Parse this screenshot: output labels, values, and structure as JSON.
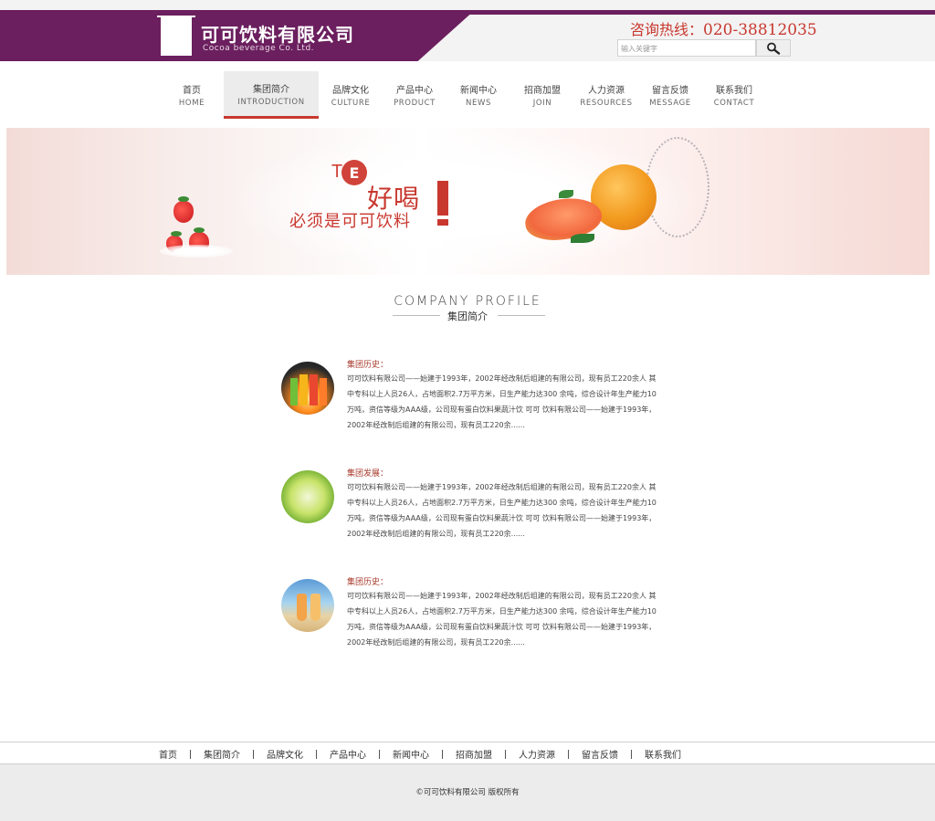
{
  "header": {
    "company_name": "可可饮料有限公司",
    "company_en": "Cocoa beverage Co. Ltd.",
    "hotline_label": "咨询热线：",
    "hotline_number": "020-38812035",
    "search_placeholder": "输入关键字",
    "brand_color": "#6b1f5e",
    "accent_color": "#c8382f"
  },
  "nav": {
    "items": [
      {
        "cn": "首页",
        "en": "HOME"
      },
      {
        "cn": "集团简介",
        "en": "INTRODUCTION"
      },
      {
        "cn": "品牌文化",
        "en": "CULTURE"
      },
      {
        "cn": "产品中心",
        "en": "PRODUCT"
      },
      {
        "cn": "新闻中心",
        "en": "NEWS"
      },
      {
        "cn": "招商加盟",
        "en": "JOIN"
      },
      {
        "cn": "人力资源",
        "en": "RESOURCES"
      },
      {
        "cn": "留言反馈",
        "en": "MESSAGE"
      },
      {
        "cn": "联系我们",
        "en": "CONTACT"
      }
    ],
    "active": "集团简介"
  },
  "banner": {
    "te": "TE",
    "slogan_big": "好喝",
    "slogan_small": "必须是可可饮料"
  },
  "section": {
    "title_en": "COMPANY PROFILE",
    "title_cn": "集团简介"
  },
  "entries": [
    {
      "heading": "集团历史：",
      "text": "可可饮料有限公司——始建于1993年，2002年经改制后组建的有限公司，现有员工220余人 其中专科以上人员26人，占地面积2.7万平方米，日生产能力达300 余吨，综合设计年生产能力10万吨，资信等级为AAA级，公司现有蛋白饮料果蔬汁饮 可可 饮料有限公司——始建于1993年，2002年经改制后组建的有限公司，现有员工220余......",
      "thumb": "juice-glasses-image"
    },
    {
      "heading": "集团发展：",
      "text": "可可饮料有限公司——始建于1993年，2002年经改制后组建的有限公司，现有员工220余人 其中专科以上人员26人，占地面积2.7万平方米，日生产能力达300 余吨，综合设计年生产能力10万吨，资信等级为AAA级，公司现有蛋白饮料果蔬汁饮 可可 饮料有限公司——始建于1993年，2002年经改制后组建的有限公司，现有员工220余......",
      "thumb": "lime-slice-image"
    },
    {
      "heading": "集团历史：",
      "text": "可可饮料有限公司——始建于1993年，2002年经改制后组建的有限公司，现有员工220余人 其中专科以上人员26人，占地面积2.7万平方米，日生产能力达300 余吨，综合设计年生产能力10万吨，资信等级为AAA级，公司现有蛋白饮料果蔬汁饮 可可 饮料有限公司——始建于1993年，2002年经改制后组建的有限公司，现有员工220余......",
      "thumb": "beach-drinks-image"
    }
  ],
  "footer": {
    "links": [
      "首页",
      "集团简介",
      "品牌文化",
      "产品中心",
      "新闻中心",
      "招商加盟",
      "人力资源",
      "留言反馈",
      "联系我们"
    ],
    "copyright": "©可可饮料有限公司 版权所有"
  }
}
